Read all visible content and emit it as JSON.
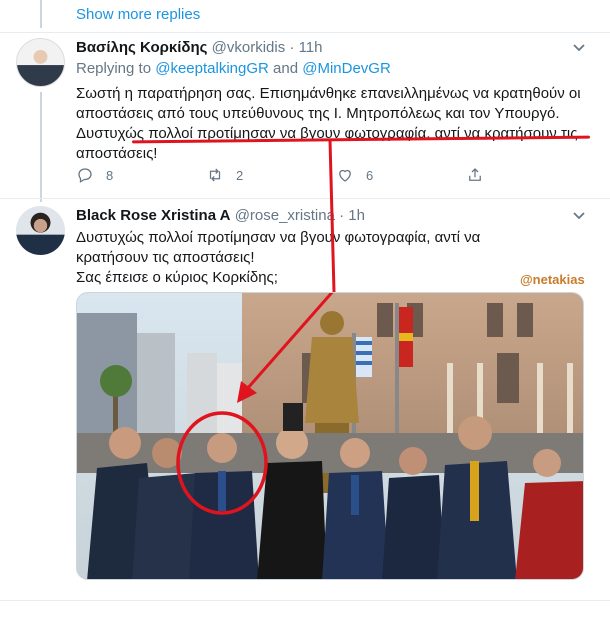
{
  "thread": {
    "show_more_label": "Show more replies"
  },
  "tweet1": {
    "name": "Βασίλης Κορκίδης",
    "handle": "@vkorkidis",
    "dot": "·",
    "time": "11h",
    "replying_prefix": "Replying to",
    "mention1": "@keeptalkingGR",
    "replying_and": "and",
    "mention2": "@MinDevGR",
    "text": "Σωστή η παρατήρηση σας. Επισημάνθηκε επανειλλημένως να κρατηθούν οι αποστάσεις από τους υπεύθυνους της Ι. Μητροπόλεως και τον Υπουργό. Δυστυχώς πολλοί προτίμησαν να βγουν φωτογραφία, αντί να κρατήσουν τις αποστάσεις!",
    "reply_count": "8",
    "retweet_count": "2",
    "like_count": "6"
  },
  "tweet2": {
    "name": "Black Rose Xristina A",
    "handle": "@rose_xristina",
    "dot": "·",
    "time": "1h",
    "text_line1": "Δυστυχώς πολλοί προτίμησαν να βγουν φωτογραφία, αντί να κρατήσουν τις αποστάσεις!",
    "text_line2": "Σας έπεισε ο κύριος Κορκίδης;",
    "watermark": "@netakias"
  },
  "icons": {
    "reply": "reply-icon",
    "retweet": "retweet-icon",
    "like": "heart-icon",
    "share": "share-icon",
    "caret": "chevron-down-icon"
  },
  "colors": {
    "link": "#1b95e0",
    "secondary": "#657786",
    "annotation_red": "#e0141e"
  }
}
